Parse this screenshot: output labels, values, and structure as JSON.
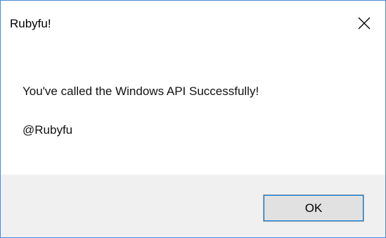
{
  "window": {
    "title": "Rubyfu!",
    "close_icon": "close-icon"
  },
  "message": {
    "line1": "You've called the Windows API Successfully!",
    "line2": "@Rubyfu"
  },
  "buttons": {
    "ok_label": "OK"
  },
  "colors": {
    "border": "#4a8ad4",
    "footer_bg": "#f0f0f0",
    "button_bg": "#e1e1e1",
    "button_focus": "#0078d7"
  }
}
